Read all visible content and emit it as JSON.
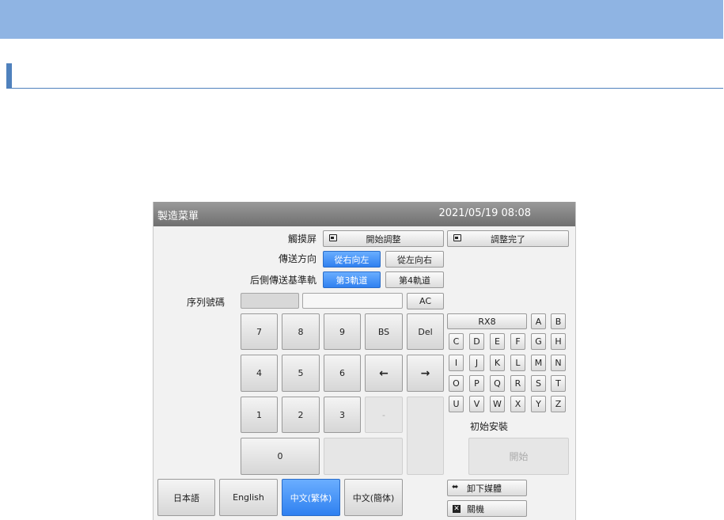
{
  "header": {
    "title": "製造菜單",
    "datetime": "2021/05/19 08:08"
  },
  "touchscreen": {
    "label": "觸摸屏",
    "start_label": "開始調整",
    "done_label": "調整完了"
  },
  "direction": {
    "label": "傳送方向",
    "right_to_left": "從右向左",
    "left_to_right": "從左向右",
    "selected": "從右向左"
  },
  "rear_rail": {
    "label": "后側傳送基準軌",
    "rail3": "第3軌道",
    "rail4": "第4軌道",
    "selected": "第3軌道"
  },
  "serial": {
    "label": "序列號碼",
    "ac_label": "AC",
    "value": ""
  },
  "numpad": {
    "k7": "7",
    "k8": "8",
    "k9": "9",
    "bs": "BS",
    "del": "Del",
    "k4": "4",
    "k5": "5",
    "k6": "6",
    "left": "←",
    "right": "→",
    "k1": "1",
    "k2": "2",
    "k3": "3",
    "dash": "-",
    "k0": "0"
  },
  "alpha": {
    "rx8": "RX8",
    "a": "A",
    "b": "B",
    "row2": [
      "C",
      "D",
      "E",
      "F",
      "G",
      "H"
    ],
    "row3": [
      "I",
      "J",
      "K",
      "L",
      "M",
      "N"
    ],
    "row4": [
      "O",
      "P",
      "Q",
      "R",
      "S",
      "T"
    ],
    "row5": [
      "U",
      "V",
      "W",
      "X",
      "Y",
      "Z"
    ]
  },
  "initial_install": {
    "label": "初始安裝",
    "start_label": "開始"
  },
  "languages": {
    "ja": "日本語",
    "en": "English",
    "zh_tw": "中文(繁体)",
    "zh_cn": "中文(簡体)",
    "selected": "中文(繁体)"
  },
  "bottom": {
    "unload": "卸下媒體",
    "shutdown": "關機"
  },
  "colors": {
    "topbar": "#8fb4e3",
    "accent_blue": "#2f80f0",
    "section": "#4f81bd"
  }
}
